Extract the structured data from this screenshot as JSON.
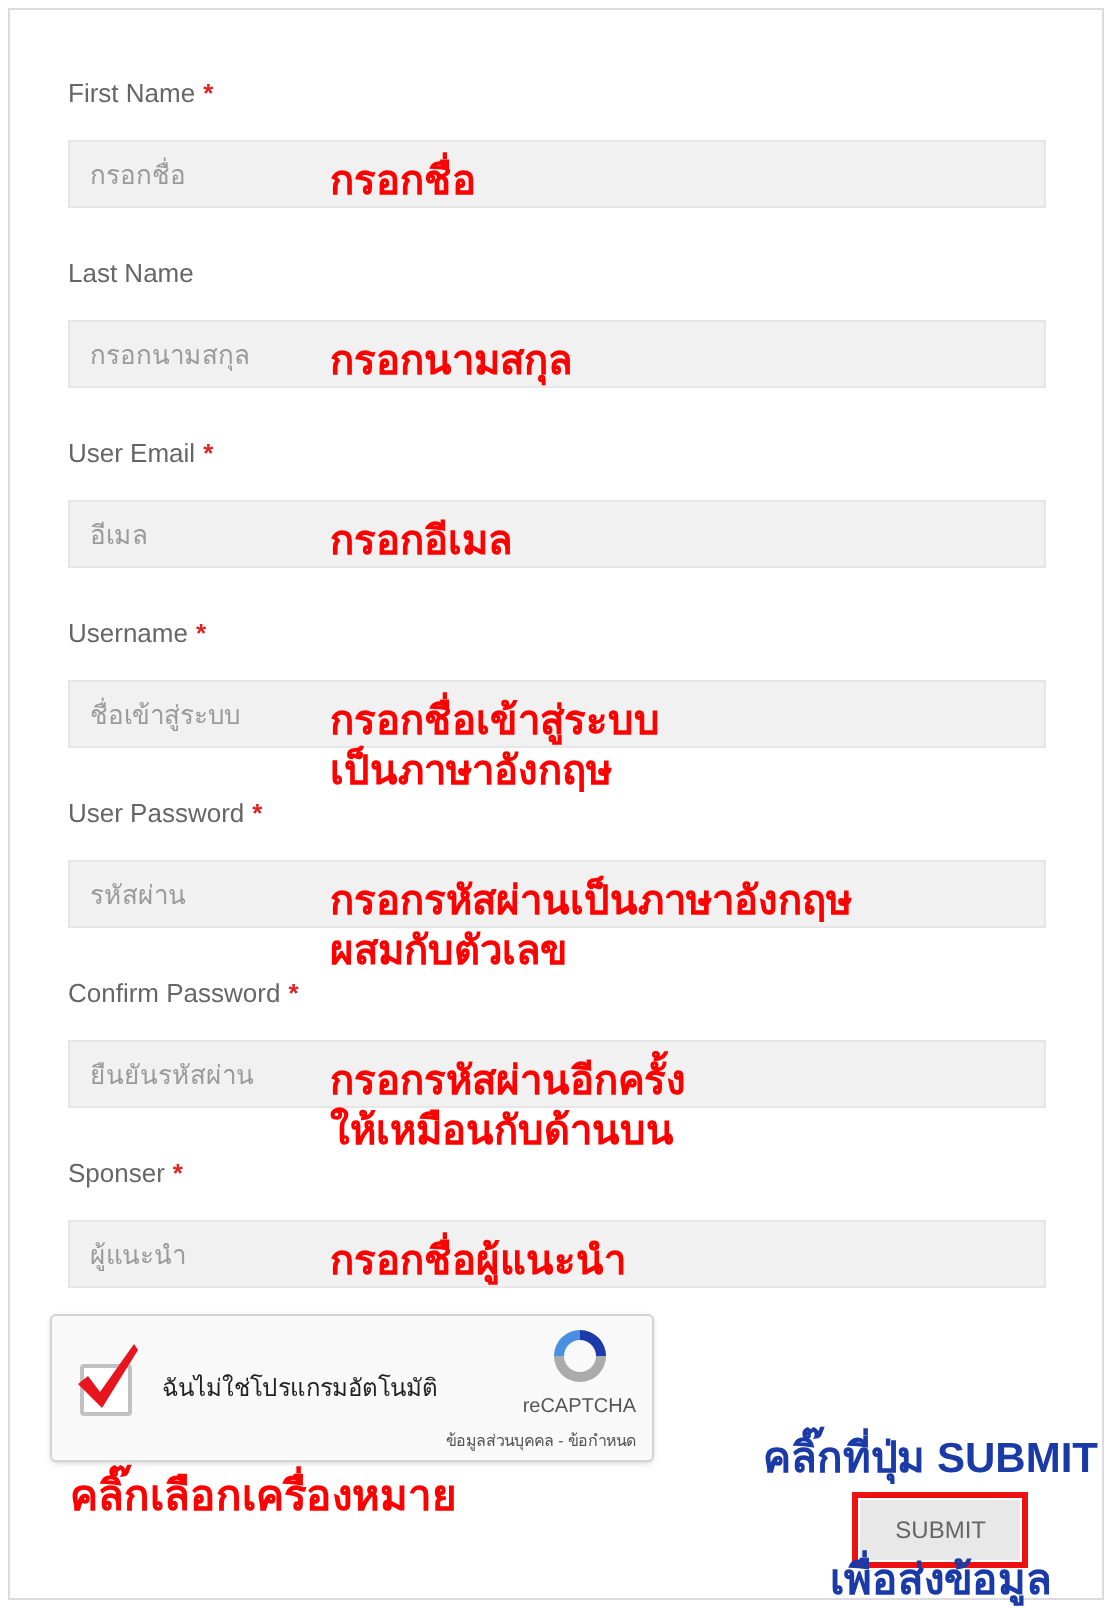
{
  "fields": [
    {
      "label": "First Name",
      "required": true,
      "placeholder": "กรอกชื่อ",
      "note": [
        "กรอกชื่อ"
      ]
    },
    {
      "label": "Last Name",
      "required": false,
      "placeholder": "กรอกนามสกุล",
      "note": [
        "กรอกนามสกุล"
      ]
    },
    {
      "label": "User Email",
      "required": true,
      "placeholder": "อีเมล",
      "note": [
        "กรอกอีเมล"
      ]
    },
    {
      "label": "Username",
      "required": true,
      "placeholder": "ชื่อเข้าสู่ระบบ",
      "note": [
        "กรอกชื่อเข้าสู่ระบบ",
        "เป็นภาษาอังกฤษ"
      ]
    },
    {
      "label": "User Password",
      "required": true,
      "placeholder": "รหัสผ่าน",
      "note": [
        "กรอกรหัสผ่านเป็นภาษาอังกฤษ",
        "ผสมกับตัวเลข"
      ]
    },
    {
      "label": "Confirm Password",
      "required": true,
      "placeholder": "ยืนยันรหัสผ่าน",
      "note": [
        "กรอกรหัสผ่านอีกครั้ง",
        "ให้เหมือนกับด้านบน"
      ]
    },
    {
      "label": "Sponser",
      "required": true,
      "placeholder": "ผู้แนะนำ",
      "note": [
        "กรอกชื่อผู้แนะนำ"
      ]
    }
  ],
  "required_mark": "*",
  "captcha": {
    "label": "ฉันไม่ใช่โปรแกรมอัตโนมัติ",
    "checked": true,
    "brand": "reCAPTCHA",
    "links": "ข้อมูลส่วนบุคคล - ข้อกำหนด",
    "note": "คลิ๊กเลือกเครื่องหมาย"
  },
  "submit": {
    "label": "SUBMIT",
    "note_above": "คลิ๊กที่ปุ่ม SUBMIT",
    "note_below": "เพื่อส่งข้อมูล"
  }
}
